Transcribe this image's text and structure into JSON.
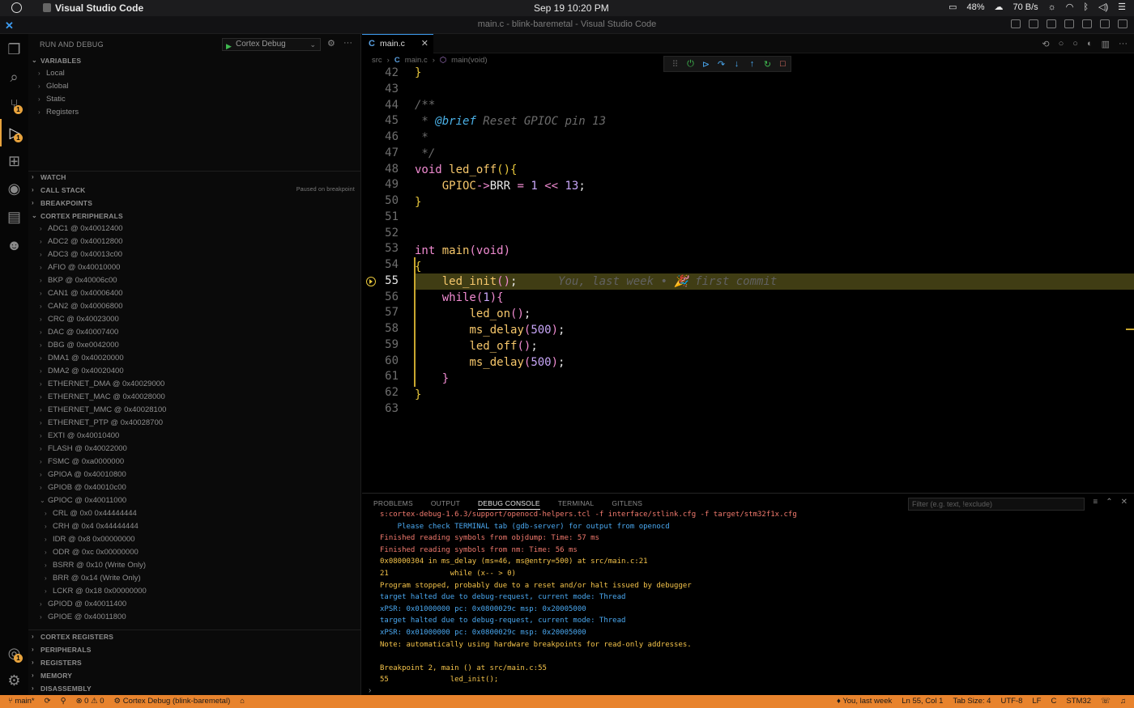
{
  "menubar": {
    "app_name": "Visual Studio Code",
    "clock": "Sep 19  10:20 PM",
    "battery": "48%",
    "network": "70 B/s"
  },
  "window": {
    "title": "main.c - blink-baremetal - Visual Studio Code"
  },
  "sidebar": {
    "header": "RUN AND DEBUG",
    "config_selected": "Cortex Debug",
    "variables_label": "VARIABLES",
    "variables": [
      "Local",
      "Global",
      "Static",
      "Registers"
    ],
    "watch_label": "WATCH",
    "callstack_label": "CALL STACK",
    "callstack_status": "Paused on breakpoint",
    "breakpoints_label": "BREAKPOINTS",
    "peripherals_label": "CORTEX PERIPHERALS",
    "peripherals": [
      "ADC1 @ 0x40012400",
      "ADC2 @ 0x40012800",
      "ADC3 @ 0x40013c00",
      "AFIO @ 0x40010000",
      "BKP @ 0x40006c00",
      "CAN1 @ 0x40006400",
      "CAN2 @ 0x40006800",
      "CRC @ 0x40023000",
      "DAC @ 0x40007400",
      "DBG @ 0xe0042000",
      "DMA1 @ 0x40020000",
      "DMA2 @ 0x40020400",
      "ETHERNET_DMA @ 0x40029000",
      "ETHERNET_MAC @ 0x40028000",
      "ETHERNET_MMC @ 0x40028100",
      "ETHERNET_PTP @ 0x40028700",
      "EXTI @ 0x40010400",
      "FLASH @ 0x40022000",
      "FSMC @ 0xa0000000",
      "GPIOA @ 0x40010800",
      "GPIOB @ 0x40010c00",
      "GPIOC @ 0x40011000"
    ],
    "gpioc_registers": [
      "CRL @ 0x0 0x44444444",
      "CRH @ 0x4 0x44444444",
      "IDR @ 0x8 0x00000000",
      "ODR @ 0xc 0x00000000",
      "BSRR @ 0x10 (Write Only)",
      "BRR @ 0x14 (Write Only)",
      "LCKR @ 0x18 0x00000000"
    ],
    "peripherals_after": [
      "GPIOD @ 0x40011400",
      "GPIOE @ 0x40011800"
    ],
    "bottom_sections": [
      "CORTEX REGISTERS",
      "PERIPHERALS",
      "REGISTERS",
      "MEMORY",
      "DISASSEMBLY"
    ]
  },
  "editor": {
    "tab_label": "main.c",
    "breadcrumb": [
      "src",
      "main.c",
      "main(void)"
    ],
    "current_line": 55,
    "blame": "You, last week • 🎉 first commit",
    "line_numbers": [
      "42",
      "43",
      "44",
      "45",
      "46",
      "47",
      "48",
      "49",
      "50",
      "51",
      "52",
      "53",
      "54",
      "55",
      "56",
      "57",
      "58",
      "59",
      "60",
      "61",
      "62",
      "63"
    ]
  },
  "panel": {
    "tabs": [
      "PROBLEMS",
      "OUTPUT",
      "DEBUG CONSOLE",
      "TERMINAL",
      "GITLENS"
    ],
    "active_tab": "DEBUG CONSOLE",
    "filter_placeholder": "Filter (e.g. text, !exclude)",
    "console": [
      {
        "text": "s:cortex-debug-1.6.3/support/openocd-helpers.tcl -f interface/stlink.cfg -f target/stm32f1x.cfg",
        "color": "red"
      },
      {
        "text": "    Please check TERMINAL tab (gdb-server) for output from openocd",
        "color": "blue"
      },
      {
        "text": "Finished reading symbols from objdump: Time: 57 ms",
        "color": "red"
      },
      {
        "text": "Finished reading symbols from nm: Time: 56 ms",
        "color": "red"
      },
      {
        "text": "0x08000304 in ms_delay (ms=46, ms@entry=500) at src/main.c:21",
        "color": "yellow"
      },
      {
        "text": "21              while (x-- > 0)",
        "color": "yellow"
      },
      {
        "text": "Program stopped, probably due to a reset and/or halt issued by debugger",
        "color": "yellow"
      },
      {
        "text": "target halted due to debug-request, current mode: Thread",
        "color": "blue"
      },
      {
        "text": "xPSR: 0x01000000 pc: 0x0800029c msp: 0x20005000",
        "color": "blue"
      },
      {
        "text": "target halted due to debug-request, current mode: Thread",
        "color": "blue"
      },
      {
        "text": "xPSR: 0x01000000 pc: 0x0800029c msp: 0x20005000",
        "color": "blue"
      },
      {
        "text": "Note: automatically using hardware breakpoints for read-only addresses.",
        "color": "yellow"
      },
      {
        "text": "",
        "color": "yellow"
      },
      {
        "text": "Breakpoint 2, main () at src/main.c:55",
        "color": "yellow"
      },
      {
        "text": "55              led_init();",
        "color": "yellow"
      }
    ]
  },
  "statusbar": {
    "branch": "main*",
    "problems": "⊗ 0 ⚠ 0",
    "debug_config": "Cortex Debug (blink-baremetal)",
    "blame": "You, last week",
    "position": "Ln 55, Col 1",
    "tab_size": "Tab Size: 4",
    "encoding": "UTF-8",
    "eol": "LF",
    "language": "C",
    "platform": "STM32"
  },
  "colors": {
    "accent": "#e8832d",
    "highlight": "#403d14"
  }
}
